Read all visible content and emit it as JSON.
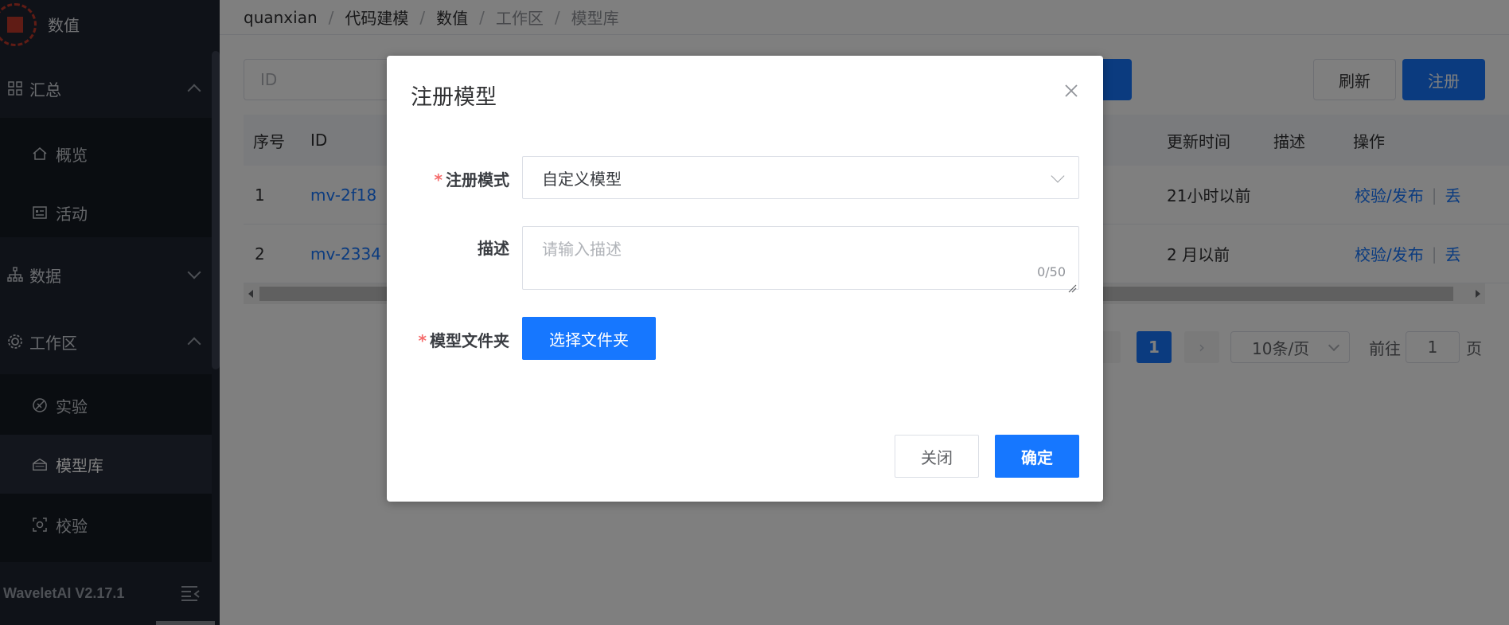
{
  "sidebar": {
    "logo_text": "数值",
    "groups": [
      {
        "label": "汇总",
        "icon": "grid-icon",
        "expanded": true
      },
      {
        "label": "数据",
        "icon": "sitemap-icon",
        "expanded": false
      },
      {
        "label": "工作区",
        "icon": "gear-icon",
        "expanded": true
      }
    ],
    "items": [
      {
        "label": "概览",
        "icon": "home-icon"
      },
      {
        "label": "活动",
        "icon": "id-card-icon"
      },
      {
        "label": "实验",
        "icon": "experiment-icon"
      },
      {
        "label": "模型库",
        "icon": "model-icon",
        "active": true
      },
      {
        "label": "校验",
        "icon": "scan-icon"
      }
    ],
    "version": "WaveletAI V2.17.1"
  },
  "breadcrumb": [
    "quanxian",
    "代码建模",
    "数值",
    "工作区",
    "模型库"
  ],
  "toolbar": {
    "search_placeholder": "ID",
    "refresh_label": "刷新",
    "register_label": "注册"
  },
  "table": {
    "headers": {
      "index": "序号",
      "id": "ID",
      "updated": "更新时间",
      "desc": "描述",
      "ops": "操作"
    },
    "rows": [
      {
        "index": "1",
        "id": "mv-2f18",
        "updated": "21小时以前",
        "desc": "",
        "op1": "校验/发布",
        "op2": "丢"
      },
      {
        "index": "2",
        "id": "mv-2334",
        "updated": "2 月以前",
        "desc": "",
        "op1": "校验/发布",
        "op2": "丢"
      }
    ]
  },
  "pagination": {
    "current": "1",
    "page_size": "10条/页",
    "goto_label": "前往",
    "goto_value": "1",
    "page_suffix": "页"
  },
  "dialog": {
    "title": "注册模型",
    "mode_label": "注册模式",
    "mode_value": "自定义模型",
    "desc_label": "描述",
    "desc_placeholder": "请输入描述",
    "desc_counter": "0/50",
    "folder_label": "模型文件夹",
    "folder_button": "选择文件夹",
    "close_button": "关闭",
    "confirm_button": "确定"
  },
  "colors": {
    "primary": "#1677ff",
    "sidebar_bg": "#1f2430",
    "required": "#f56c6c"
  }
}
